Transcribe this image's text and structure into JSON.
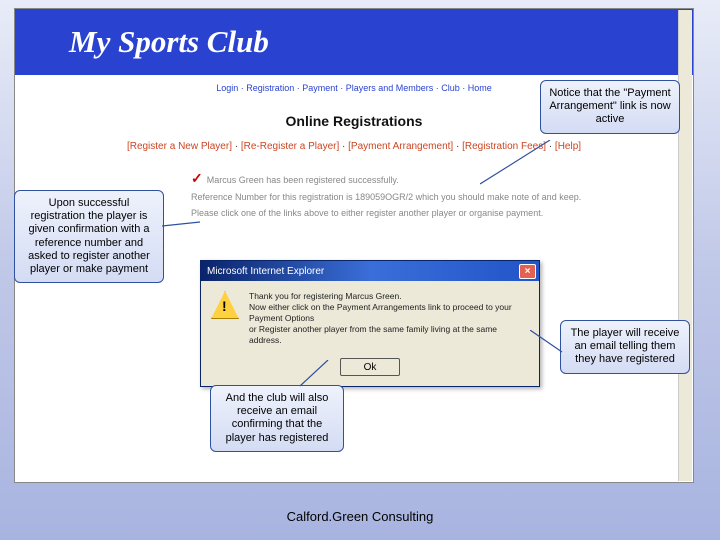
{
  "site": {
    "title": "My Sports Club"
  },
  "breadcrumb": "Login · Registration · Payment · Players and Members · Club · Home",
  "pageTitle": "Online Registrations",
  "nav": {
    "l1": "[Register a New Player]",
    "l2": "[Re-Register a Player]",
    "l3": "[Payment Arrangement]",
    "l4": "[Registration Fees]",
    "l5": "[Help]"
  },
  "success": {
    "line1": "Marcus Green has been registered successfully.",
    "line2": "Reference Number for this registration is 189059OGR/2 which you should make note of and keep.",
    "line3": "Please click one of the links above to either register another player or organise payment."
  },
  "dialog": {
    "title": "Microsoft Internet Explorer",
    "msg1": "Thank you for registering Marcus Green.",
    "msg2": "Now either click on the Payment Arrangements link to proceed to your Payment Options",
    "msg3": "or Register another player from the same family living at the same address.",
    "ok": "Ok"
  },
  "callouts": {
    "c1": "Notice that the \"Payment Arrangement\" link is now active",
    "c2": "Upon successful registration the player is given confirmation with a reference number and asked to register another player or make payment",
    "c3": "And the club will also receive an email confirming that the player has registered",
    "c4": "The player will receive an email telling them they have registered"
  },
  "footer": "Calford.Green Consulting"
}
